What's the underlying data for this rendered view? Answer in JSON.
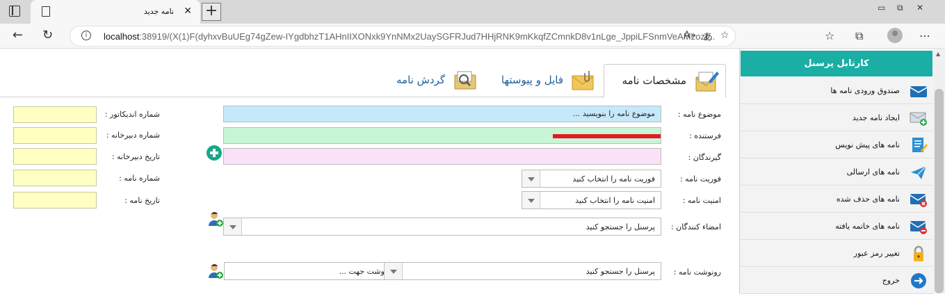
{
  "browser": {
    "tab_title": "نامه جدید",
    "url_host": "localhost",
    "url_rest": ":38919/(X(1)F(dyhxvBuUEg74gZew-IYgdbhzT1AHnIIXONxk9YnNMx2UaySGFRJud7HHjRNK9mKkqfZCmnkD8v1nLge_JppiLFSnmVeAMzozr..."
  },
  "sidebar": {
    "title": "کارتابل پرسنل",
    "items": [
      {
        "label": "صندوق ورودی نامه ها",
        "icon": "inbox-envelope-icon"
      },
      {
        "label": "ایجاد نامه جدید",
        "icon": "new-letter-icon"
      },
      {
        "label": "نامه های پیش نویس",
        "icon": "draft-icon"
      },
      {
        "label": "نامه های ارسالی",
        "icon": "sent-plane-icon"
      },
      {
        "label": "نامه های حذف شده",
        "icon": "deleted-envelope-icon"
      },
      {
        "label": "نامه های خاتمه یافته",
        "icon": "finished-envelope-icon"
      },
      {
        "label": "تغییر رمز عبور",
        "icon": "lock-icon"
      },
      {
        "label": "خروج",
        "icon": "exit-arrow-icon"
      }
    ]
  },
  "tabs": [
    {
      "label": "مشخصات نامه",
      "icon": "letter-edit-icon"
    },
    {
      "label": "فایل و پیوستها",
      "icon": "attachment-envelope-icon"
    },
    {
      "label": "گردش نامه",
      "icon": "letter-search-icon"
    }
  ],
  "form": {
    "subject_label": "موضوع نامه :",
    "subject_placeholder": "موضوع نامه را بنویسید ...",
    "sender_label": "فرستنده :",
    "recipients_label": "گیرندگان :",
    "urgency_label": "فوریت نامه :",
    "urgency_value": "فوریت نامه را انتخاب کنید",
    "security_label": "امنیت نامه :",
    "security_value": "امنیت نامه را انتخاب کنید",
    "signers_label": "امضاء کنندگان :",
    "signers_value": "پرسنل را جستجو کنید",
    "cc_label": "رونوشت نامه :",
    "cc_person_value": "پرسنل را جستجو کنید",
    "cc_purpose_value": "رونوشت جهت ..."
  },
  "meta": {
    "indicator_label": "شماره اندیکاتور :",
    "secretariat_no_label": "شماره دبیرخانه :",
    "secretariat_date_label": "تاریخ دبیرخانه :",
    "letter_no_label": "شماره نامه :",
    "letter_date_label": "تاریخ نامه :"
  },
  "colors": {
    "sidebar_header": "#1aaea4",
    "subject_bg": "#c6e8fb",
    "sender_bg": "#c9f5d7",
    "recipients_bg": "#fbe2f9",
    "meta_bg": "#ffffc2"
  }
}
